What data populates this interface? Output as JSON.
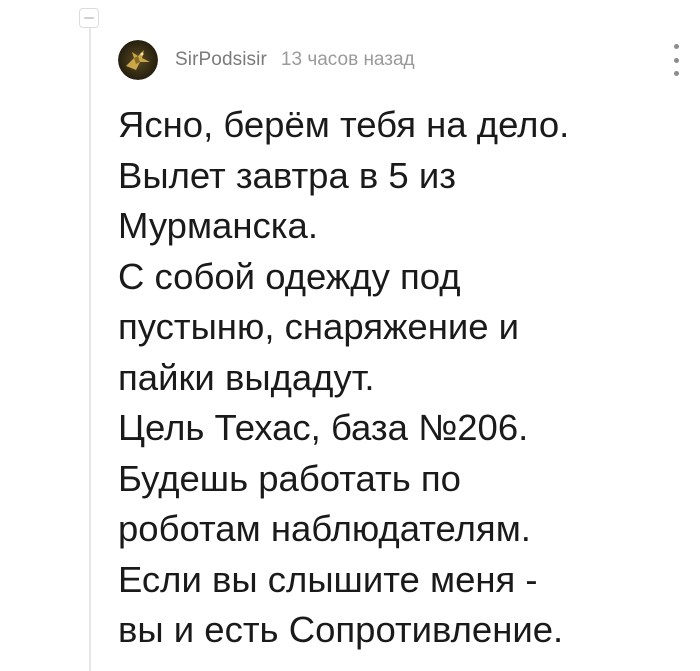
{
  "comment": {
    "author": "SirPodsisir",
    "timestamp": "13 часов назад",
    "avatar_icon": "bird-avatar-icon",
    "text_lines": [
      "Ясно, берём тебя на дело.",
      "Вылет завтра в 5 из",
      "Мурманска.",
      "С собой одежду под",
      "пустыню, снаряжение и",
      "пайки выдадут.",
      "Цель Техас, база №206.",
      "Будешь работать по",
      "роботам наблюдателям.",
      "Если вы слышите меня -",
      "вы и есть Сопротивление."
    ]
  },
  "colors": {
    "author": "#7a7a7a",
    "timestamp": "#9a9a9a",
    "body_text": "#1a1a1a",
    "thread_line": "#e6e6e6"
  }
}
